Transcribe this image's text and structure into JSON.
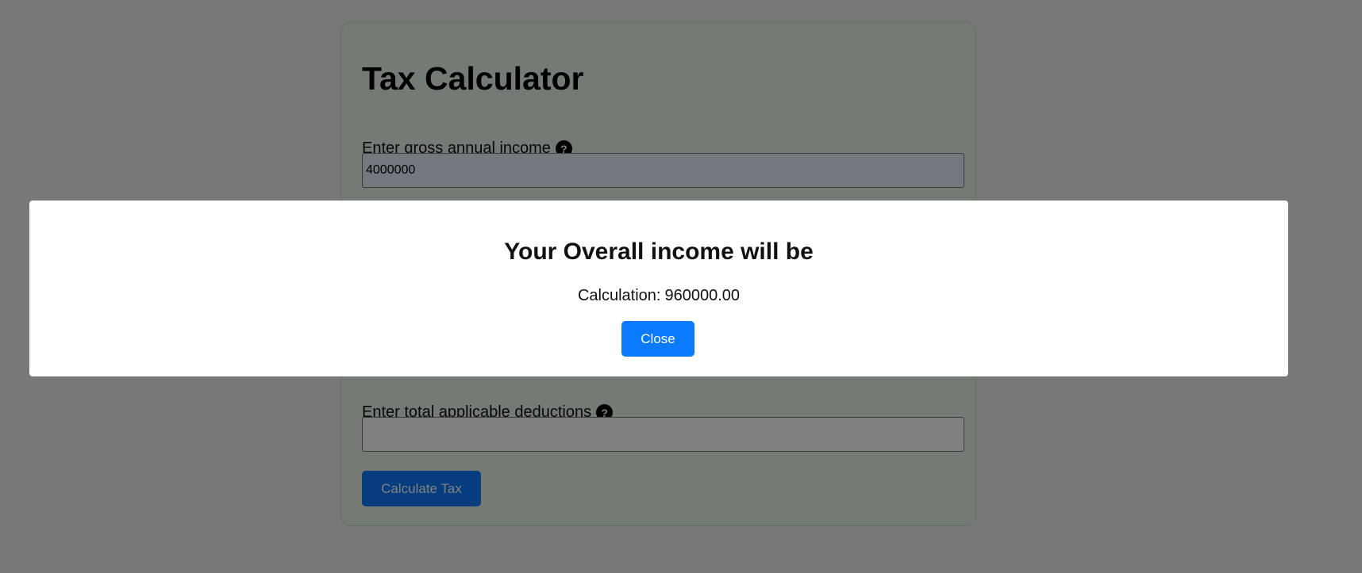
{
  "form": {
    "title": "Tax Calculator",
    "gross_income": {
      "label": "Enter gross annual income",
      "value": "4000000"
    },
    "deductions": {
      "label": "Enter total applicable deductions",
      "value": ""
    },
    "help_glyph": "?",
    "submit_label": "Calculate Tax"
  },
  "modal": {
    "title": "Your Overall income will be",
    "calc_label": "Calculation:",
    "calc_value": "960000.00",
    "close_label": "Close"
  },
  "colors": {
    "card_bg": "#e8f5e9",
    "accent": "#0a7aff",
    "overlay": "rgba(0,0,0,0.5)"
  },
  "icons": {
    "help": "question-circle-icon"
  }
}
